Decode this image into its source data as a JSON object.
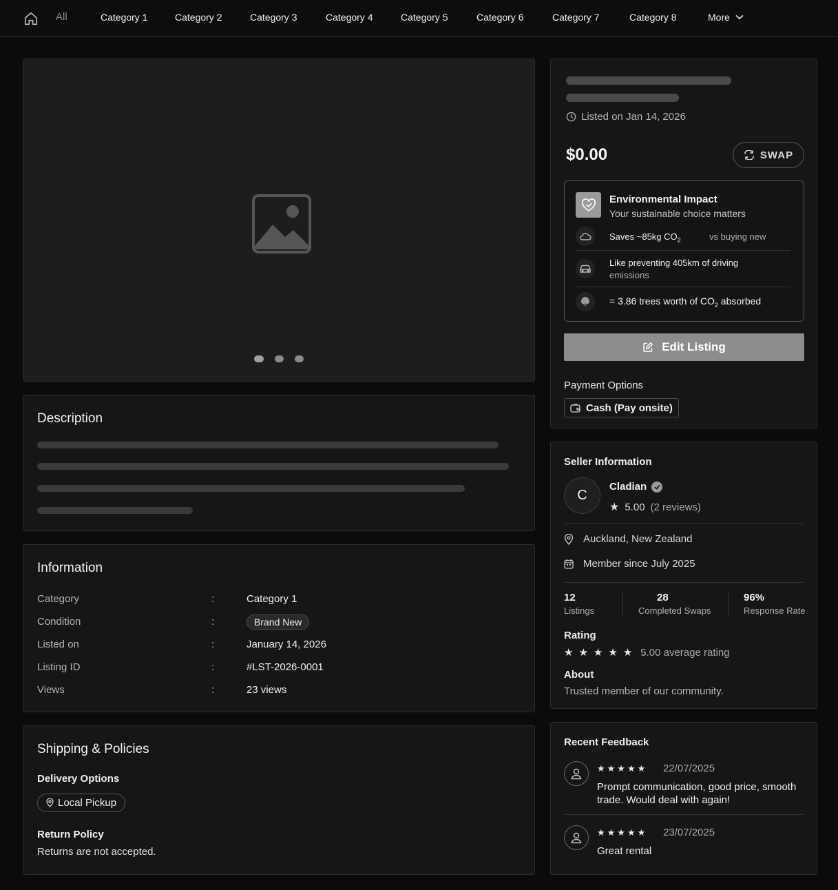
{
  "nav": {
    "all": "All",
    "categories": [
      "Category 1",
      "Category 2",
      "Category 3",
      "Category 4",
      "Category 5",
      "Category 6",
      "Category 7",
      "Category 8"
    ],
    "more": "More"
  },
  "gallery": {
    "slides": 3,
    "active_slide": 1
  },
  "description": {
    "title": "Description"
  },
  "information": {
    "title": "Information",
    "rows": [
      {
        "label": "Category",
        "value": "Category 1"
      },
      {
        "label": "Condition",
        "value": "Brand New"
      },
      {
        "label": "Listed on",
        "value": "January 14, 2026"
      },
      {
        "label": "Listing ID",
        "value": "#LST-2026-0001"
      },
      {
        "label": "Views",
        "value": "23 views"
      }
    ],
    "separator": ":"
  },
  "shipping": {
    "title": "Shipping & Policies",
    "delivery_title": "Delivery Options",
    "delivery_option": "Local Pickup",
    "return_title": "Return Policy",
    "return_text": "Returns are not accepted."
  },
  "summary": {
    "listed": "Listed on Jan 14, 2026",
    "price": "$0.00",
    "swap": "SWAP",
    "env": {
      "title": "Environmental Impact",
      "subtitle": "Your sustainable choice matters",
      "saves": "Saves ~85kg CO",
      "saves_sub": "2",
      "vs": "vs buying new",
      "driving_1": "Like preventing 405km of driving",
      "driving_2": "emissions",
      "trees_a": "= 3.86 trees worth of CO",
      "trees_sub": "2",
      "trees_b": " absorbed"
    },
    "edit": "Edit Listing",
    "payment_title": "Payment Options",
    "payment_option": "Cash (Pay onsite)"
  },
  "seller": {
    "title": "Seller Information",
    "initial": "C",
    "name": "Cladian",
    "rating": "5.00",
    "reviews": "(2 reviews)",
    "location": "Auckland, New Zealand",
    "member_since": "Member since July 2025",
    "stats": [
      {
        "value": "12",
        "label": "Listings"
      },
      {
        "value": "28",
        "label": "Completed Swaps"
      },
      {
        "value": "96%",
        "label": "Response Rate"
      }
    ],
    "rating_title": "Rating",
    "rating_stars": 5,
    "rating_text": "5.00 average rating",
    "about_title": "About",
    "about": "Trusted member of our community."
  },
  "feedback": {
    "title": "Recent Feedback",
    "items": [
      {
        "stars": "★★★★★",
        "date": "22/07/2025",
        "text": "Prompt communication, good price, smooth trade. Would deal with again!"
      },
      {
        "stars": "★★★★★",
        "date": "23/07/2025",
        "text": "Great rental"
      }
    ]
  }
}
